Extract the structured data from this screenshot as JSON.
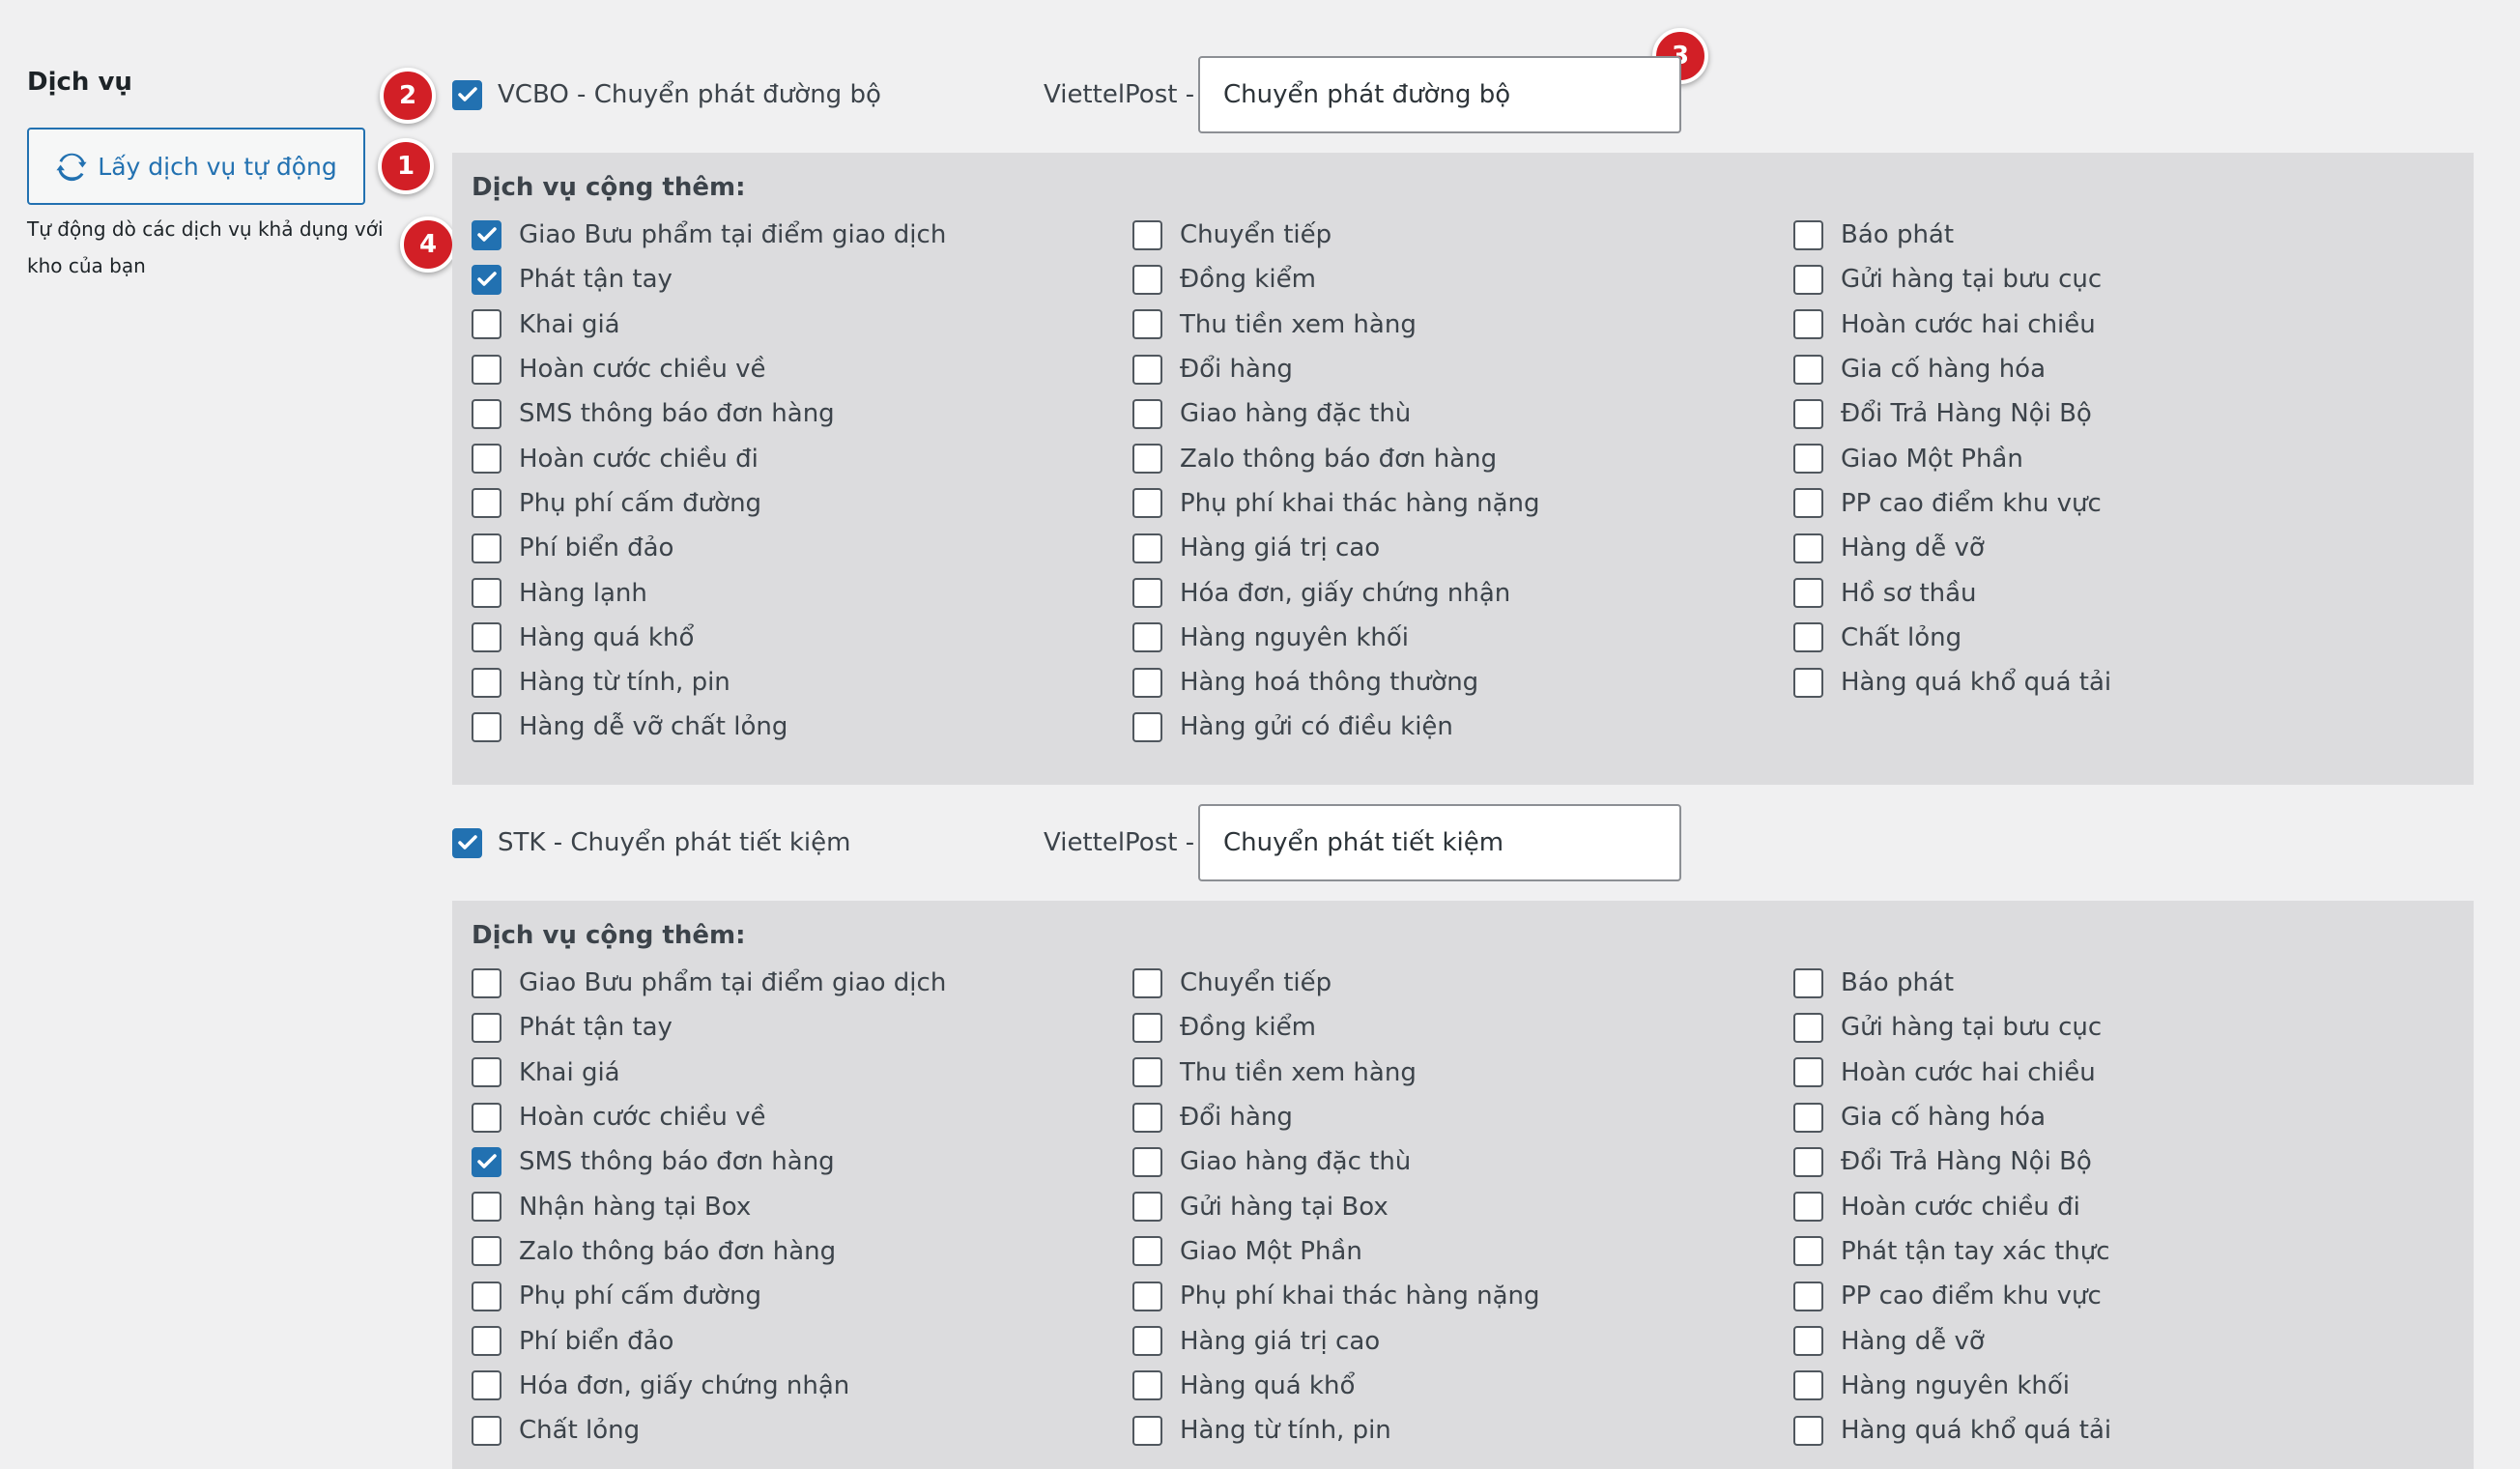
{
  "section": {
    "label": "Dịch vụ"
  },
  "fetch": {
    "button_label": "Lấy dịch vụ tự động",
    "help": "Tự động dò các dịch vụ khả dụng với kho của bạn"
  },
  "badges": [
    "1",
    "2",
    "3",
    "4"
  ],
  "colors": {
    "accent": "#2271b1",
    "badge": "#d21f26",
    "panel": "#dcdcde",
    "background": "#f0f0f1"
  },
  "services": [
    {
      "label": "VCBO - Chuyển phát đường bộ",
      "checked": true,
      "provider_label": "ViettelPost -",
      "name_value": "Chuyển phát đường bộ",
      "addon_title": "Dịch vụ cộng thêm:",
      "addons": [
        [
          {
            "label": "Giao Bưu phẩm tại điểm giao dịch",
            "checked": true
          },
          {
            "label": "Phát tận tay",
            "checked": true
          },
          {
            "label": "Khai giá",
            "checked": false
          },
          {
            "label": "Hoàn cước chiều về",
            "checked": false
          },
          {
            "label": "SMS thông báo đơn hàng",
            "checked": false
          },
          {
            "label": "Hoàn cước chiều đi",
            "checked": false
          },
          {
            "label": "Phụ phí cấm đường",
            "checked": false
          },
          {
            "label": "Phí biển đảo",
            "checked": false
          },
          {
            "label": "Hàng lạnh",
            "checked": false
          },
          {
            "label": "Hàng quá khổ",
            "checked": false
          },
          {
            "label": "Hàng từ tính, pin",
            "checked": false
          },
          {
            "label": "Hàng dễ vỡ chất lỏng",
            "checked": false
          }
        ],
        [
          {
            "label": "Chuyển tiếp",
            "checked": false
          },
          {
            "label": "Đồng kiểm",
            "checked": false
          },
          {
            "label": "Thu tiền xem hàng",
            "checked": false
          },
          {
            "label": "Đổi hàng",
            "checked": false
          },
          {
            "label": "Giao hàng đặc thù",
            "checked": false
          },
          {
            "label": "Zalo thông báo đơn hàng",
            "checked": false
          },
          {
            "label": "Phụ phí khai thác hàng nặng",
            "checked": false
          },
          {
            "label": "Hàng giá trị cao",
            "checked": false
          },
          {
            "label": "Hóa đơn, giấy chứng nhận",
            "checked": false
          },
          {
            "label": "Hàng nguyên khối",
            "checked": false
          },
          {
            "label": "Hàng hoá thông thường",
            "checked": false
          },
          {
            "label": "Hàng gửi có điều kiện",
            "checked": false
          }
        ],
        [
          {
            "label": "Báo phát",
            "checked": false
          },
          {
            "label": "Gửi hàng tại bưu cục",
            "checked": false
          },
          {
            "label": "Hoàn cước hai chiều",
            "checked": false
          },
          {
            "label": "Gia cố hàng hóa",
            "checked": false
          },
          {
            "label": "Đổi Trả Hàng Nội Bộ",
            "checked": false
          },
          {
            "label": "Giao Một Phần",
            "checked": false
          },
          {
            "label": "PP cao điểm khu vực",
            "checked": false
          },
          {
            "label": "Hàng dễ vỡ",
            "checked": false
          },
          {
            "label": "Hồ sơ thầu",
            "checked": false
          },
          {
            "label": "Chất lỏng",
            "checked": false
          },
          {
            "label": "Hàng quá khổ quá tải",
            "checked": false
          }
        ]
      ]
    },
    {
      "label": "STK - Chuyển phát tiết kiệm",
      "checked": true,
      "provider_label": "ViettelPost -",
      "name_value": "Chuyển phát tiết kiệm",
      "addon_title": "Dịch vụ cộng thêm:",
      "addons": [
        [
          {
            "label": "Giao Bưu phẩm tại điểm giao dịch",
            "checked": false
          },
          {
            "label": "Phát tận tay",
            "checked": false
          },
          {
            "label": "Khai giá",
            "checked": false
          },
          {
            "label": "Hoàn cước chiều về",
            "checked": false
          },
          {
            "label": "SMS thông báo đơn hàng",
            "checked": true
          },
          {
            "label": "Nhận hàng tại Box",
            "checked": false
          },
          {
            "label": "Zalo thông báo đơn hàng",
            "checked": false
          },
          {
            "label": "Phụ phí cấm đường",
            "checked": false
          },
          {
            "label": "Phí biển đảo",
            "checked": false
          },
          {
            "label": "Hóa đơn, giấy chứng nhận",
            "checked": false
          },
          {
            "label": "Chất lỏng",
            "checked": false
          }
        ],
        [
          {
            "label": "Chuyển tiếp",
            "checked": false
          },
          {
            "label": "Đồng kiểm",
            "checked": false
          },
          {
            "label": "Thu tiền xem hàng",
            "checked": false
          },
          {
            "label": "Đổi hàng",
            "checked": false
          },
          {
            "label": "Giao hàng đặc thù",
            "checked": false
          },
          {
            "label": "Gửi hàng tại Box",
            "checked": false
          },
          {
            "label": "Giao Một Phần",
            "checked": false
          },
          {
            "label": "Phụ phí khai thác hàng nặng",
            "checked": false
          },
          {
            "label": "Hàng giá trị cao",
            "checked": false
          },
          {
            "label": "Hàng quá khổ",
            "checked": false
          },
          {
            "label": "Hàng từ tính, pin",
            "checked": false
          }
        ],
        [
          {
            "label": "Báo phát",
            "checked": false
          },
          {
            "label": "Gửi hàng tại bưu cục",
            "checked": false
          },
          {
            "label": "Hoàn cước hai chiều",
            "checked": false
          },
          {
            "label": "Gia cố hàng hóa",
            "checked": false
          },
          {
            "label": "Đổi Trả Hàng Nội Bộ",
            "checked": false
          },
          {
            "label": "Hoàn cước chiều đi",
            "checked": false
          },
          {
            "label": "Phát tận tay xác thực",
            "checked": false
          },
          {
            "label": "PP cao điểm khu vực",
            "checked": false
          },
          {
            "label": "Hàng dễ vỡ",
            "checked": false
          },
          {
            "label": "Hàng nguyên khối",
            "checked": false
          },
          {
            "label": "Hàng quá khổ quá tải",
            "checked": false
          }
        ]
      ]
    }
  ]
}
